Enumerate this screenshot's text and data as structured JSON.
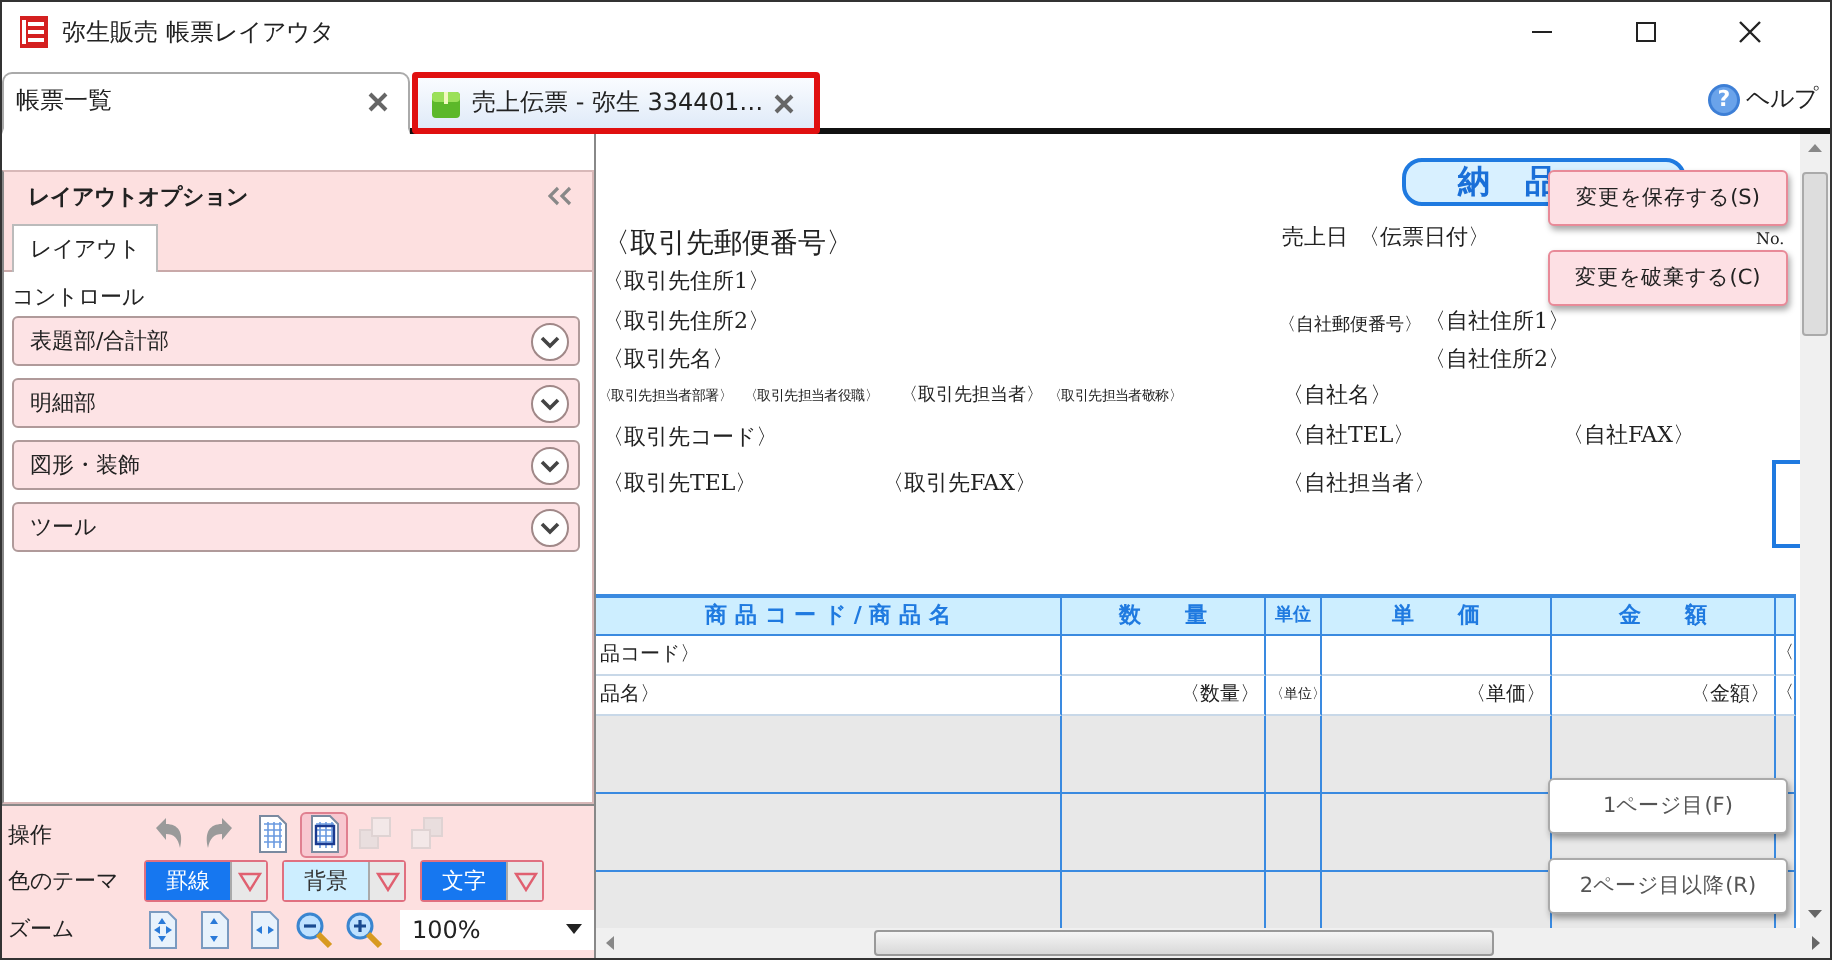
{
  "window": {
    "title": "弥生販売 帳票レイアウタ"
  },
  "tabs": [
    {
      "label": "帳票一覧",
      "selected": false,
      "highlighted": false
    },
    {
      "label": "売上伝票 - 弥生 334401…",
      "selected": true,
      "highlighted": true
    }
  ],
  "help": {
    "icon": "?",
    "label": "ヘルプ"
  },
  "panel": {
    "title": "レイアウトオプション",
    "tabs": [
      {
        "label": "レイアウト",
        "selected": true
      }
    ],
    "section_label": "コントロール",
    "groups": [
      {
        "label": "表題部/合計部",
        "expanded": false
      },
      {
        "label": "明細部",
        "expanded": false
      },
      {
        "label": "図形・装飾",
        "expanded": false
      },
      {
        "label": "ツール",
        "expanded": false
      }
    ]
  },
  "toolbar": {
    "operations": {
      "label": "操作",
      "tools": [
        {
          "kind": "undo",
          "disabled": false,
          "selected": false
        },
        {
          "kind": "redo",
          "disabled": false,
          "selected": false
        },
        {
          "kind": "page",
          "disabled": false,
          "selected": false
        },
        {
          "kind": "page-select",
          "disabled": false,
          "selected": true
        },
        {
          "kind": "front",
          "disabled": true,
          "selected": false
        },
        {
          "kind": "back",
          "disabled": true,
          "selected": false
        }
      ]
    },
    "theme": {
      "label": "色のテーマ",
      "swatches": [
        {
          "label": "罫線",
          "color": "#1677f0"
        },
        {
          "label": "背景",
          "color": "#cdeeff"
        },
        {
          "label": "文字",
          "color": "#1677f0"
        }
      ]
    },
    "zoom": {
      "label": "ズーム",
      "tools": [
        {
          "kind": "fit-page"
        },
        {
          "kind": "fit-height"
        },
        {
          "kind": "fit-width"
        },
        {
          "kind": "zoom-out"
        },
        {
          "kind": "zoom-in"
        }
      ],
      "value": "100%"
    }
  },
  "canvas": {
    "title": "納 品",
    "fields": [
      {
        "text": "〈取引先郵便番号〉"
      },
      {
        "text": "売上日"
      },
      {
        "text": "〈伝票日付〉"
      },
      {
        "text": "No."
      },
      {
        "text": "〈取引先住所1〉"
      },
      {
        "text": "〈取引先住所2〉"
      },
      {
        "text": "〈取引先名〉"
      },
      {
        "text": "〈取引先担当者部署〉"
      },
      {
        "text": "〈取引先担当者役職〉"
      },
      {
        "text": "〈取引先担当者〉"
      },
      {
        "text": "〈取引先担当者敬称〉"
      },
      {
        "text": "〈取引先コード〉"
      },
      {
        "text": "〈取引先TEL〉"
      },
      {
        "text": "〈取引先FAX〉"
      },
      {
        "text": "〈自社郵便番号〉"
      },
      {
        "text": "〈自社住所1〉"
      },
      {
        "text": "〈自社住所2〉"
      },
      {
        "text": "〈自社名〉"
      },
      {
        "text": "〈自社TEL〉"
      },
      {
        "text": "〈自社FAX〉"
      },
      {
        "text": "〈自社担当者〉"
      }
    ],
    "table": {
      "columns": [
        "商 品 コ ー ド / 商 品 名",
        "数　　量",
        "単位",
        "単　　価",
        "金　　額",
        null
      ],
      "rows": [
        {
          "kind": "field",
          "cells": [
            "品コード〉",
            null,
            null,
            null,
            null,
            "〈"
          ]
        },
        {
          "kind": "field",
          "cells": [
            "品名〉",
            "〈数量〉",
            "〈単位〉",
            "〈単価〉",
            "〈金額〉",
            "〈"
          ]
        },
        {
          "kind": "blank"
        },
        {
          "kind": "blank"
        },
        {
          "kind": "blank"
        }
      ]
    },
    "actions": [
      {
        "label": "変更を保存する(S)"
      },
      {
        "label": "変更を破棄する(C)"
      }
    ],
    "page_buttons": [
      {
        "label": "1ページ目(F)"
      },
      {
        "label": "2ページ目以降(R)"
      }
    ]
  }
}
